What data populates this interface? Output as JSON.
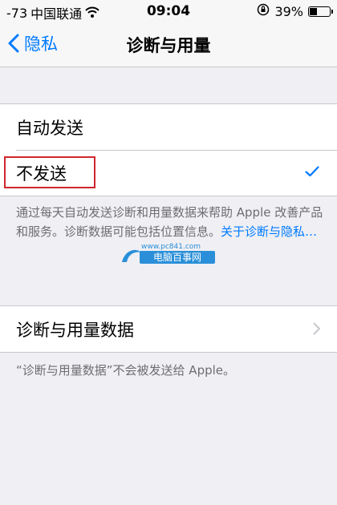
{
  "statusbar": {
    "signal": "-73",
    "carrier": "中国联通",
    "time": "09:04",
    "battery": "39%",
    "battery_level": 0.39
  },
  "nav": {
    "back_label": "隐私",
    "title": "诊断与用量"
  },
  "send_options": [
    {
      "label": "自动发送",
      "selected": false
    },
    {
      "label": "不发送",
      "selected": true
    }
  ],
  "description": {
    "text": "通过每天自动发送诊断和用量数据来帮助 Apple 改善产品和服务。诊断数据可能包括位置信息。",
    "link": "关于诊断与隐私…"
  },
  "data_row": {
    "label": "诊断与用量数据"
  },
  "data_footer": "“诊断与用量数据”不会被发送给 Apple。",
  "watermark": {
    "url": "www.pc841.com",
    "name": "电脑百事网"
  },
  "colors": {
    "accent": "#007aff",
    "highlight": "#d0262d",
    "footer_text": "#6d6d72"
  },
  "icons": [
    "wifi-icon",
    "orientation-lock-icon",
    "battery-icon",
    "chevron-left-icon",
    "checkmark-icon",
    "chevron-right-icon"
  ]
}
